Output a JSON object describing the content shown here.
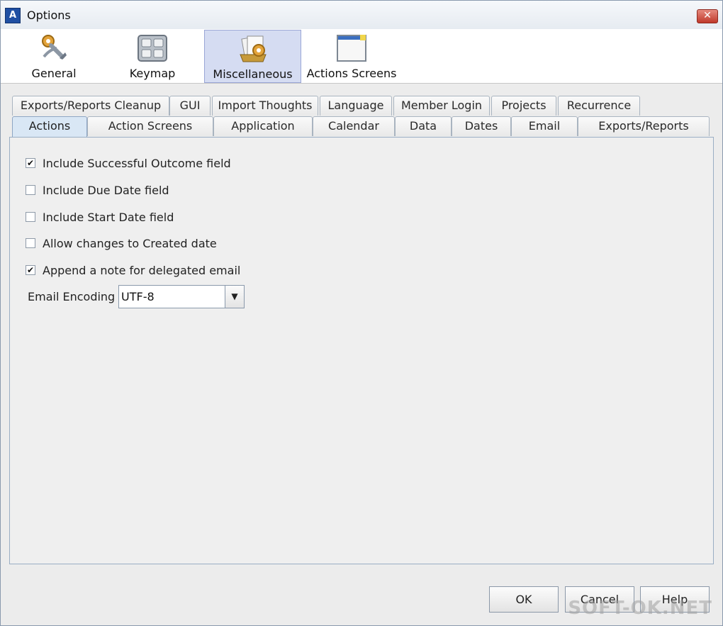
{
  "window": {
    "title": "Options",
    "close_label": "✕"
  },
  "toolbar": {
    "items": [
      {
        "label": "General",
        "icon": "gear-wrench-icon"
      },
      {
        "label": "Keymap",
        "icon": "keyboard-icon"
      },
      {
        "label": "Miscellaneous",
        "icon": "misc-gear-icon",
        "selected": true
      },
      {
        "label": "Actions Screens",
        "icon": "window-icon"
      }
    ]
  },
  "tabs": {
    "row1": [
      "Exports/Reports Cleanup",
      "GUI",
      "Import Thoughts",
      "Language",
      "Member Login",
      "Projects",
      "Recurrence"
    ],
    "row2": [
      "Actions",
      "Action Screens",
      "Application",
      "Calendar",
      "Data",
      "Dates",
      "Email",
      "Exports/Reports"
    ],
    "active": "Actions"
  },
  "actions_panel": {
    "options": [
      {
        "label": "Include Successful Outcome field",
        "checked": true
      },
      {
        "label": "Include Due Date field",
        "checked": false
      },
      {
        "label": "Include Start Date field",
        "checked": false
      },
      {
        "label": "Allow changes to Created date",
        "checked": false
      },
      {
        "label": "Append a note for delegated email",
        "checked": true
      }
    ],
    "email_encoding": {
      "label": "Email Encoding",
      "value": "UTF-8"
    }
  },
  "buttons": {
    "ok": "OK",
    "cancel": "Cancel",
    "help": "Help"
  },
  "watermark": "SOFT-OK.NET",
  "colors": {
    "selected_tool_bg": "#d5dcf2",
    "active_tab_bg": "#d9e7f5"
  }
}
